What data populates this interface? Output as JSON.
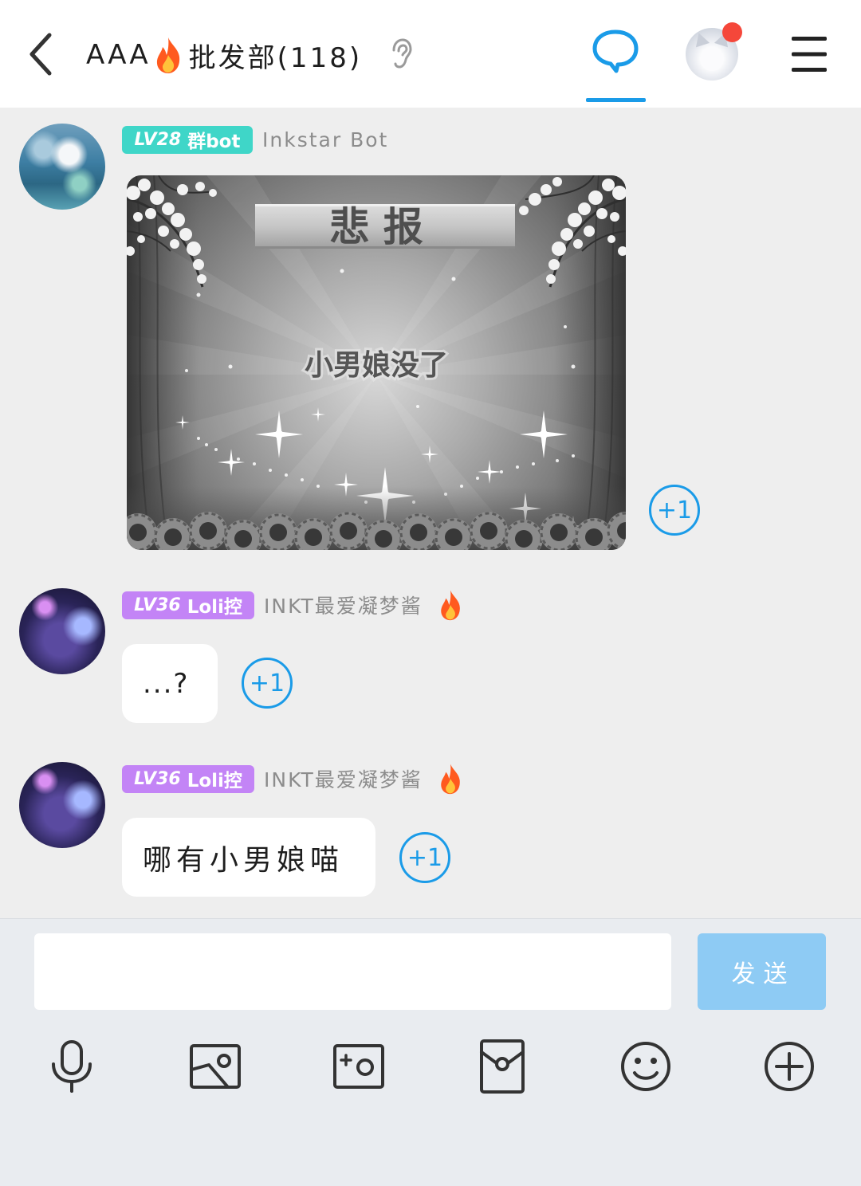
{
  "header": {
    "back_icon": "back-arrow-icon",
    "title_prefix": "AAA",
    "title_icon": "fire-icon",
    "title_name": "批发部(118)",
    "status_icon": "ear-icon",
    "tabs": [
      {
        "icon": "chat-bubble-icon",
        "active": true
      },
      {
        "icon": "group-avatar",
        "notification_dot": true
      }
    ],
    "menu_icon": "menu-icon"
  },
  "messages": [
    {
      "badge": {
        "level": "LV28",
        "title": "群bot",
        "color": "#3fd6c8"
      },
      "sender": "Inkstar Bot",
      "kind": "image",
      "image": {
        "banner": "悲 报",
        "caption": "小男娘没了"
      },
      "plus_one": "+1"
    },
    {
      "badge": {
        "level": "LV36",
        "title": "Loli控",
        "color": "#c384f6"
      },
      "sender": "INKT最爱凝梦酱",
      "sender_icon": "fire-icon",
      "kind": "text",
      "text": "...?",
      "plus_one": "+1"
    },
    {
      "badge": {
        "level": "LV36",
        "title": "Loli控",
        "color": "#c384f6"
      },
      "sender": "INKT最爱凝梦酱",
      "sender_icon": "fire-icon",
      "kind": "text",
      "text": "哪有小男娘喵",
      "plus_one": "+1"
    }
  ],
  "composer": {
    "input_value": "",
    "input_placeholder": "",
    "send_label": "发送"
  },
  "toolbar": [
    {
      "icon": "microphone-icon"
    },
    {
      "icon": "image-icon"
    },
    {
      "icon": "camera-icon"
    },
    {
      "icon": "red-packet-icon"
    },
    {
      "icon": "emoji-icon"
    },
    {
      "icon": "plus-circle-icon"
    }
  ],
  "colors": {
    "accent": "#1a9be8",
    "send_button": "#8ecbf4",
    "notification_dot": "#f5473a",
    "chat_background": "#eeeeee",
    "composer_background": "#e9ecf0"
  }
}
